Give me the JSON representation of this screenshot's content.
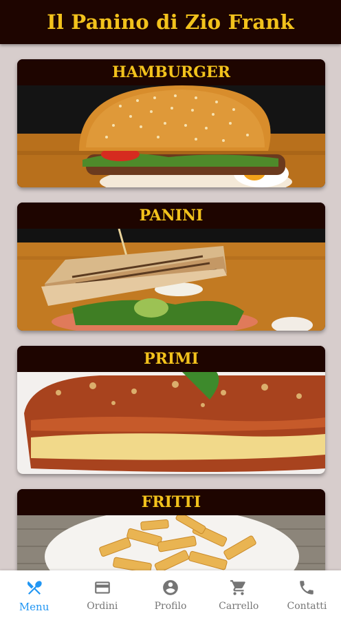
{
  "app": {
    "title": "Il Panino di Zio Frank"
  },
  "categories": [
    {
      "title": "HAMBURGER",
      "image": "hamburger-photo"
    },
    {
      "title": "PANINI",
      "image": "sandwich-photo"
    },
    {
      "title": "PRIMI",
      "image": "lasagna-photo"
    },
    {
      "title": "FRITTI",
      "image": "fries-photo"
    }
  ],
  "nav": [
    {
      "label": "Menu",
      "icon": "utensils-icon",
      "active": true
    },
    {
      "label": "Ordini",
      "icon": "credit-card-icon",
      "active": false
    },
    {
      "label": "Profilo",
      "icon": "account-circle-icon",
      "active": false
    },
    {
      "label": "Carrello",
      "icon": "cart-icon",
      "active": false
    },
    {
      "label": "Contatti",
      "icon": "phone-icon",
      "active": false
    }
  ],
  "colors": {
    "bar": "#1e0500",
    "accent": "#f2c21c",
    "active": "#2196f3",
    "inactive": "#757575"
  }
}
